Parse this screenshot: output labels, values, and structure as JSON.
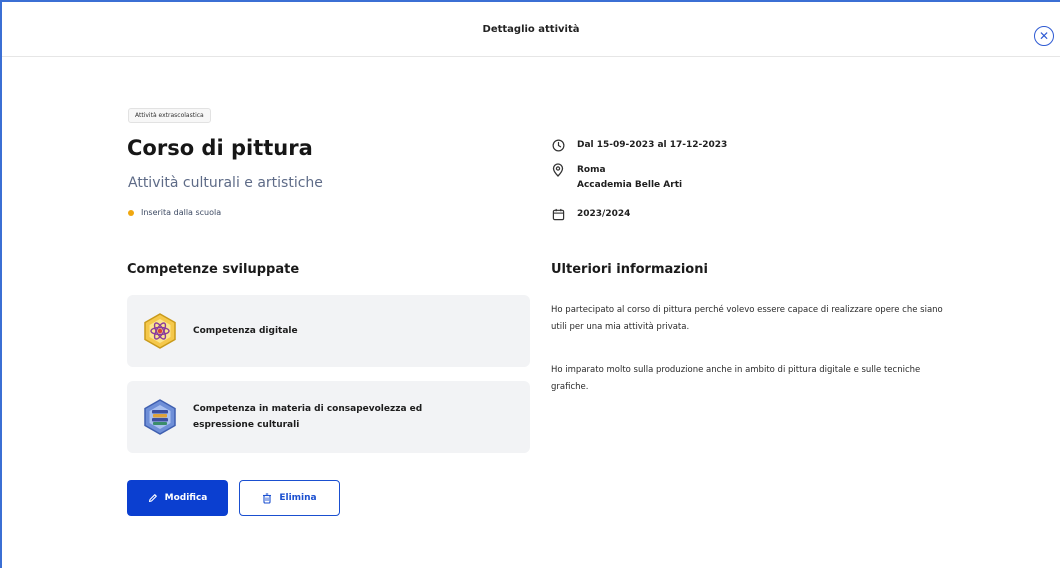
{
  "header": {
    "title": "Dettaglio attività",
    "close_icon": "close-icon"
  },
  "activity": {
    "badge": "Attività extrascolastica",
    "title": "Corso di pittura",
    "category": "Attività culturali e artistiche",
    "status": "Inserita dalla scuola",
    "status_color": "#f0a70f"
  },
  "details": {
    "dates": "Dal 15-09-2023 al 17-12-2023",
    "city": "Roma",
    "place": "Accademia Belle Arti",
    "school_year": "2023/2024"
  },
  "competences": {
    "section_title": "Competenze sviluppate",
    "items": [
      {
        "label": "Competenza digitale",
        "icon": "digital-competence-icon"
      },
      {
        "label": "Competenza in materia di consapevolezza ed espressione culturali",
        "icon": "cultural-competence-icon"
      }
    ]
  },
  "more_info": {
    "section_title": "Ulteriori informazioni",
    "paragraph_1": "Ho partecipato al corso di pittura perché volevo essere capace di realizzare opere che siano utili per una mia attività privata.",
    "paragraph_2": "Ho imparato molto sulla produzione anche in ambito di pittura digitale e sulle tecniche grafiche."
  },
  "actions": {
    "edit_label": "Modifica",
    "delete_label": "Elimina"
  },
  "colors": {
    "primary": "#0b3fd0",
    "accent_border": "#3b6fd4"
  }
}
